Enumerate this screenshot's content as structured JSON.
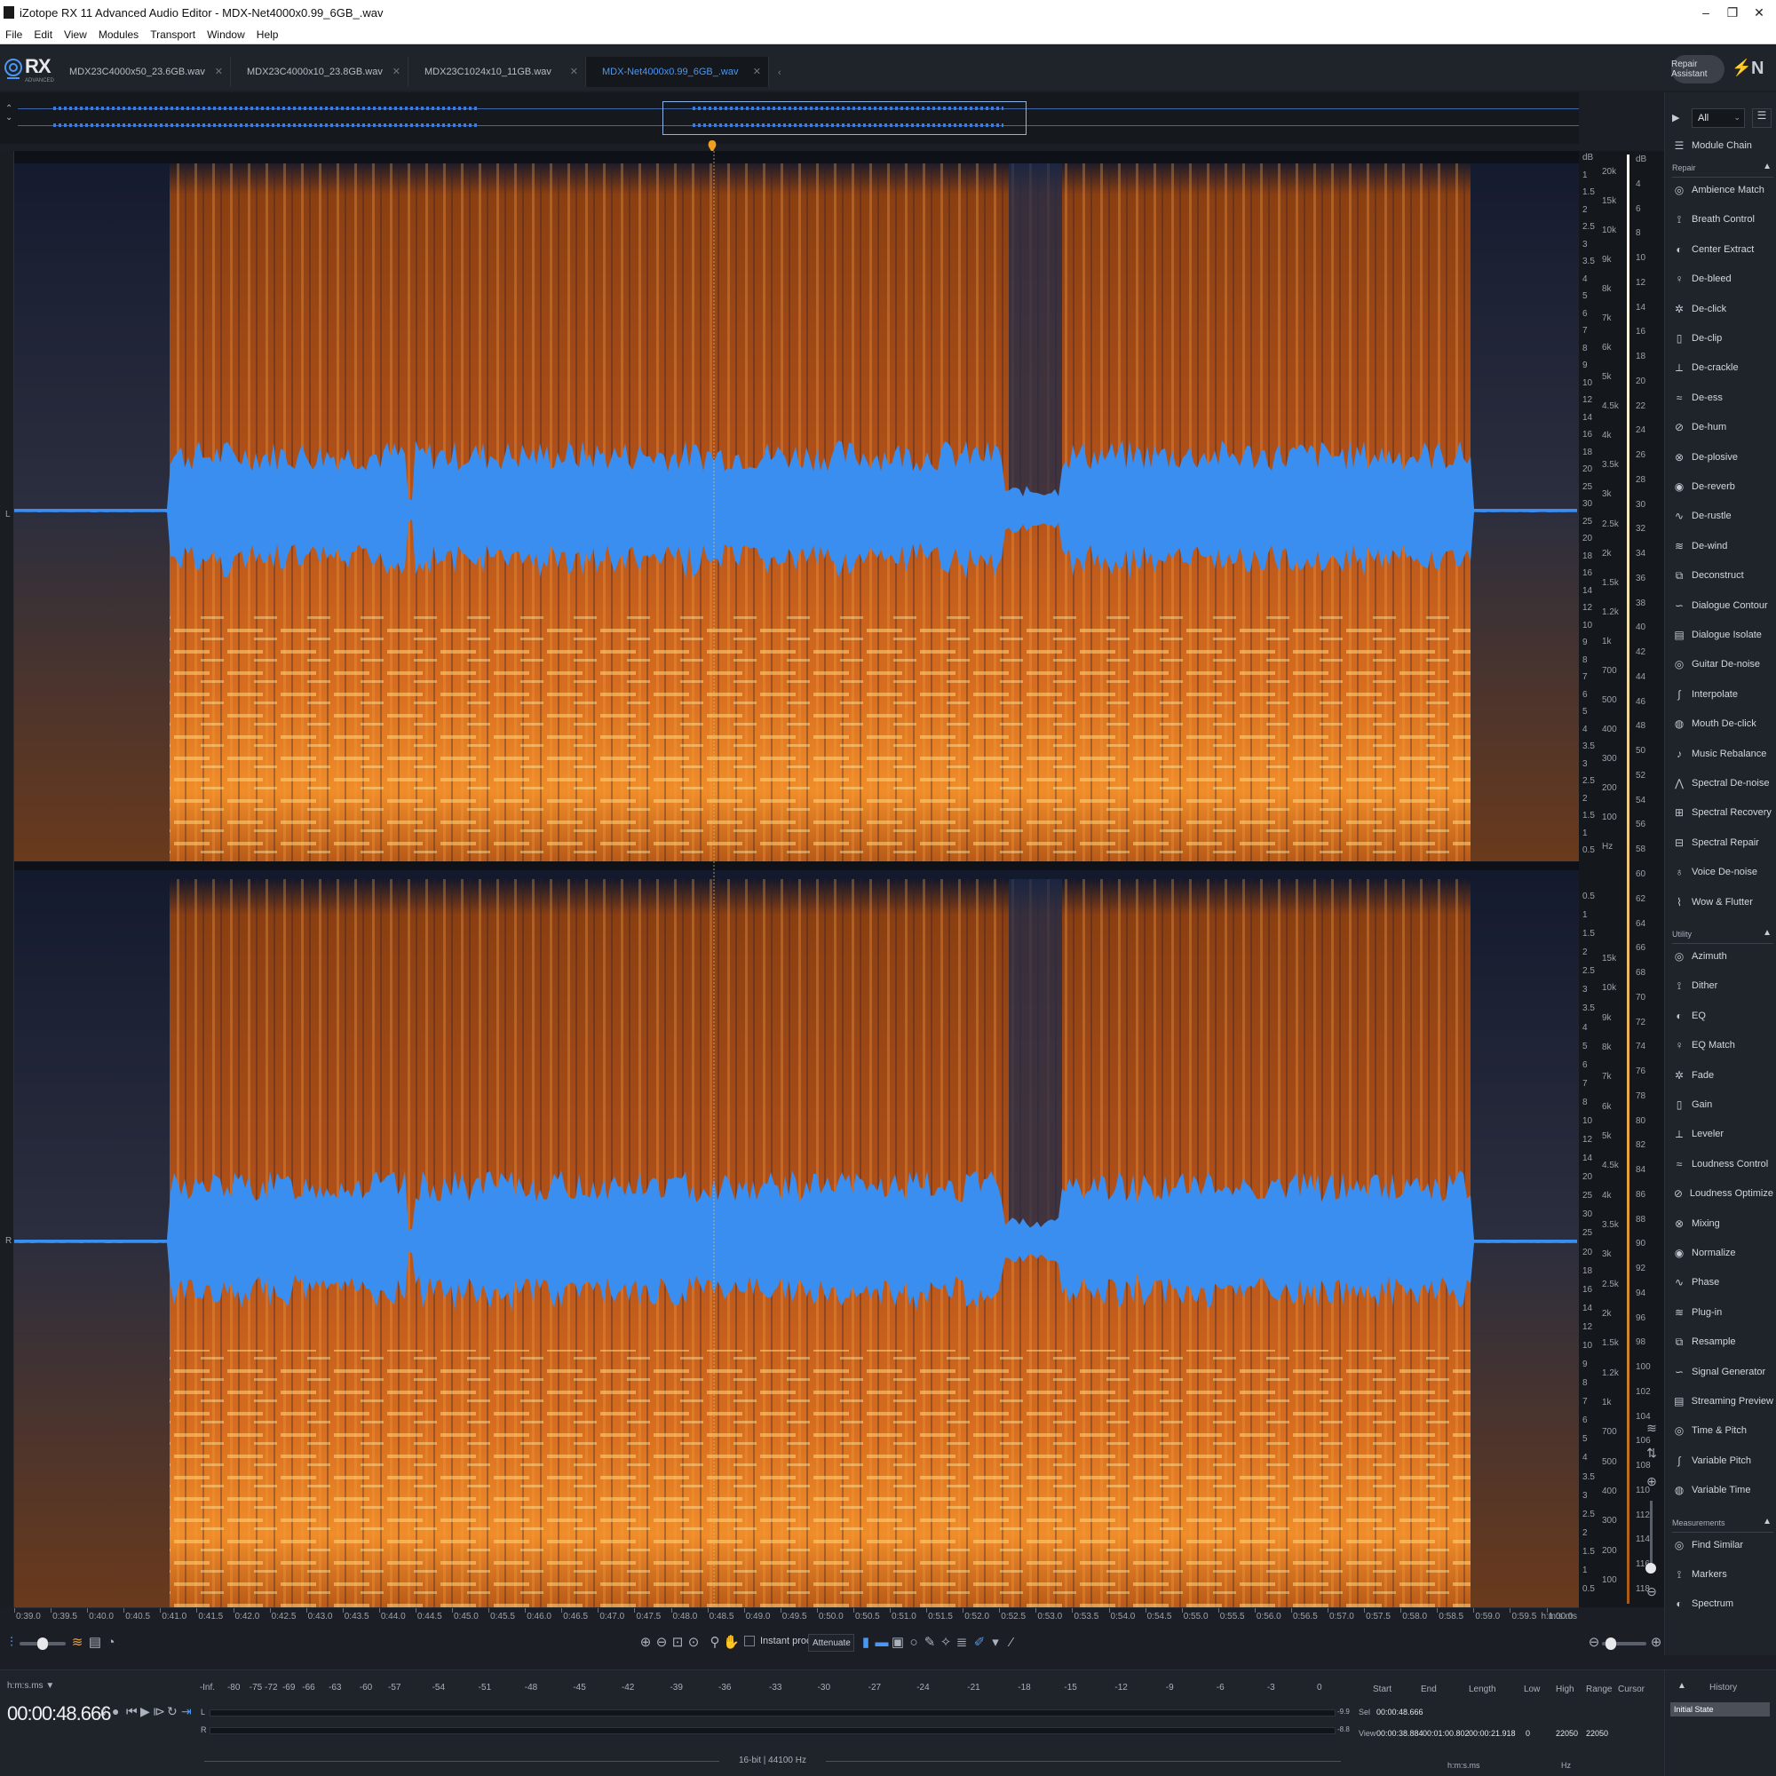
{
  "window": {
    "title": "iZotope RX 11 Advanced Audio Editor - MDX-Net4000x0.99_6GB_.wav",
    "controls": [
      "–",
      "❐",
      "✕"
    ]
  },
  "menu": [
    "File",
    "Edit",
    "View",
    "Modules",
    "Transport",
    "Window",
    "Help"
  ],
  "logo": {
    "text": "RX",
    "subtitle": "ADVANCED"
  },
  "tabs": [
    {
      "label": "MDX23C4000x50_23.6GB.wav",
      "active": false
    },
    {
      "label": "MDX23C4000x10_23.8GB.wav",
      "active": false
    },
    {
      "label": "MDX23C1024x10_11GB.wav",
      "active": false
    },
    {
      "label": "MDX-Net4000x0.99_6GB_.wav",
      "active": true
    }
  ],
  "repair_assistant": "Repair Assistant",
  "ni_logo": "N",
  "channels": [
    "L",
    "R"
  ],
  "colors": {
    "accent": "#4b98f2",
    "waveform": "#3a8ef0",
    "spectrogram_hot": "#ffe7a0",
    "spectrogram_mid": "#e07a20",
    "spectrogram_low": "#1c2a4a",
    "background": "#1b1e24"
  },
  "db_scale": {
    "top": [
      "dB",
      "1",
      "1.5",
      "2",
      "2.5",
      "3",
      "3.5",
      "4",
      "5",
      "6",
      "7",
      "8",
      "9",
      "10",
      "12",
      "14",
      "16",
      "18",
      "20",
      "25",
      "30",
      "25",
      "20",
      "18",
      "16",
      "14",
      "12",
      "10",
      "9",
      "8",
      "7",
      "6",
      "5",
      "4",
      "3.5",
      "3",
      "2.5",
      "2",
      "1.5",
      "1",
      "0.5"
    ],
    "bottom": [
      "0.5",
      "1",
      "1.5",
      "2",
      "2.5",
      "3",
      "3.5",
      "4",
      "5",
      "6",
      "7",
      "8",
      "10",
      "12",
      "14",
      "20",
      "25",
      "30",
      "25",
      "20",
      "18",
      "16",
      "14",
      "12",
      "10",
      "9",
      "8",
      "7",
      "6",
      "5",
      "4",
      "3.5",
      "3",
      "2.5",
      "2",
      "1.5",
      "1",
      "0.5"
    ]
  },
  "hz_scale": {
    "top": [
      "20k",
      "15k",
      "10k",
      "9k",
      "8k",
      "7k",
      "6k",
      "5k",
      "4.5k",
      "4k",
      "3.5k",
      "3k",
      "2.5k",
      "2k",
      "1.5k",
      "1.2k",
      "1k",
      "700",
      "500",
      "400",
      "300",
      "200",
      "100",
      "Hz"
    ],
    "bottom": [
      "15k",
      "10k",
      "9k",
      "8k",
      "7k",
      "6k",
      "5k",
      "4.5k",
      "4k",
      "3.5k",
      "3k",
      "2.5k",
      "2k",
      "1.5k",
      "1.2k",
      "1k",
      "700",
      "500",
      "400",
      "300",
      "200",
      "100"
    ]
  },
  "meter_scale": [
    "dB",
    "4",
    "6",
    "8",
    "10",
    "12",
    "14",
    "16",
    "18",
    "20",
    "22",
    "24",
    "26",
    "28",
    "30",
    "32",
    "34",
    "36",
    "38",
    "40",
    "42",
    "44",
    "46",
    "48",
    "50",
    "52",
    "54",
    "56",
    "58",
    "60",
    "62",
    "64",
    "66",
    "68",
    "70",
    "72",
    "74",
    "76",
    "78",
    "80",
    "82",
    "84",
    "86",
    "88",
    "90",
    "92",
    "94",
    "96",
    "98",
    "100",
    "102",
    "104",
    "106",
    "108",
    "110",
    "112",
    "114",
    "116",
    "118"
  ],
  "time_ruler": {
    "labels": [
      "0:39.0",
      "0:39.5",
      "0:40.0",
      "0:40.5",
      "0:41.0",
      "0:41.5",
      "0:42.0",
      "0:42.5",
      "0:43.0",
      "0:43.5",
      "0:44.0",
      "0:44.5",
      "0:45.0",
      "0:45.5",
      "0:46.0",
      "0:46.5",
      "0:47.0",
      "0:47.5",
      "0:48.0",
      "0:48.5",
      "0:49.0",
      "0:49.5",
      "0:50.0",
      "0:50.5",
      "0:51.0",
      "0:51.5",
      "0:52.0",
      "0:52.5",
      "0:53.0",
      "0:53.5",
      "0:54.0",
      "0:54.5",
      "0:55.0",
      "0:55.5",
      "0:56.0",
      "0:56.5",
      "0:57.0",
      "0:57.5",
      "0:58.0",
      "0:58.5",
      "0:59.0",
      "0:59.5",
      "1:00.0"
    ],
    "unit": "h:m:s.ms"
  },
  "toolbar": {
    "instant_process": "Instant process",
    "attenuate": "Attenuate"
  },
  "status": {
    "time_format": "h:m:s.ms ▼",
    "time": "00:00:48.666",
    "bit_depth": "16-bit | 44100 Hz",
    "level_ticks": [
      "-Inf.",
      "-80",
      "-75",
      "-72",
      "-69",
      "-66",
      "-63",
      "-60",
      "-57",
      "-54",
      "-51",
      "-48",
      "-45",
      "-42",
      "-39",
      "-36",
      "-33",
      "-30",
      "-27",
      "-24",
      "-21",
      "-18",
      "-15",
      "-12",
      "-9",
      "-6",
      "-3",
      "0"
    ],
    "peaks": [
      "-9.9",
      "-8.8"
    ]
  },
  "selection": {
    "headers": [
      "Start",
      "End",
      "Length",
      "Low",
      "High",
      "Range",
      "Cursor"
    ],
    "sel_label": "Sel",
    "view_label": "View",
    "sel": {
      "start": "00:00:48.666"
    },
    "view": {
      "start": "00:00:38.884",
      "end": "00:01:00.802",
      "length": "00:00:21.918",
      "low": "0",
      "high": "22050",
      "range": "22050"
    },
    "time_unit": "h:m:s.ms",
    "freq_unit": "Hz"
  },
  "modules": {
    "filter": "All",
    "module_chain": "Module Chain",
    "sections": [
      {
        "name": "Repair",
        "items": [
          "Ambience Match",
          "Breath Control",
          "Center Extract",
          "De-bleed",
          "De-click",
          "De-clip",
          "De-crackle",
          "De-ess",
          "De-hum",
          "De-plosive",
          "De-reverb",
          "De-rustle",
          "De-wind",
          "Deconstruct",
          "Dialogue Contour",
          "Dialogue Isolate",
          "Guitar De-noise",
          "Interpolate",
          "Mouth De-click",
          "Music Rebalance",
          "Spectral De-noise",
          "Spectral Recovery",
          "Spectral Repair",
          "Voice De-noise",
          "Wow & Flutter"
        ]
      },
      {
        "name": "Utility",
        "items": [
          "Azimuth",
          "Dither",
          "EQ",
          "EQ Match",
          "Fade",
          "Gain",
          "Leveler",
          "Loudness Control",
          "Loudness Optimize",
          "Mixing",
          "Normalize",
          "Phase",
          "Plug-in",
          "Resample",
          "Signal Generator",
          "Streaming Preview",
          "Time & Pitch",
          "Variable Pitch",
          "Variable Time"
        ]
      },
      {
        "name": "Measurements",
        "items": [
          "Find Similar",
          "Markers",
          "Spectrum"
        ]
      }
    ]
  },
  "history": {
    "title": "History",
    "items": [
      "Initial State"
    ]
  }
}
